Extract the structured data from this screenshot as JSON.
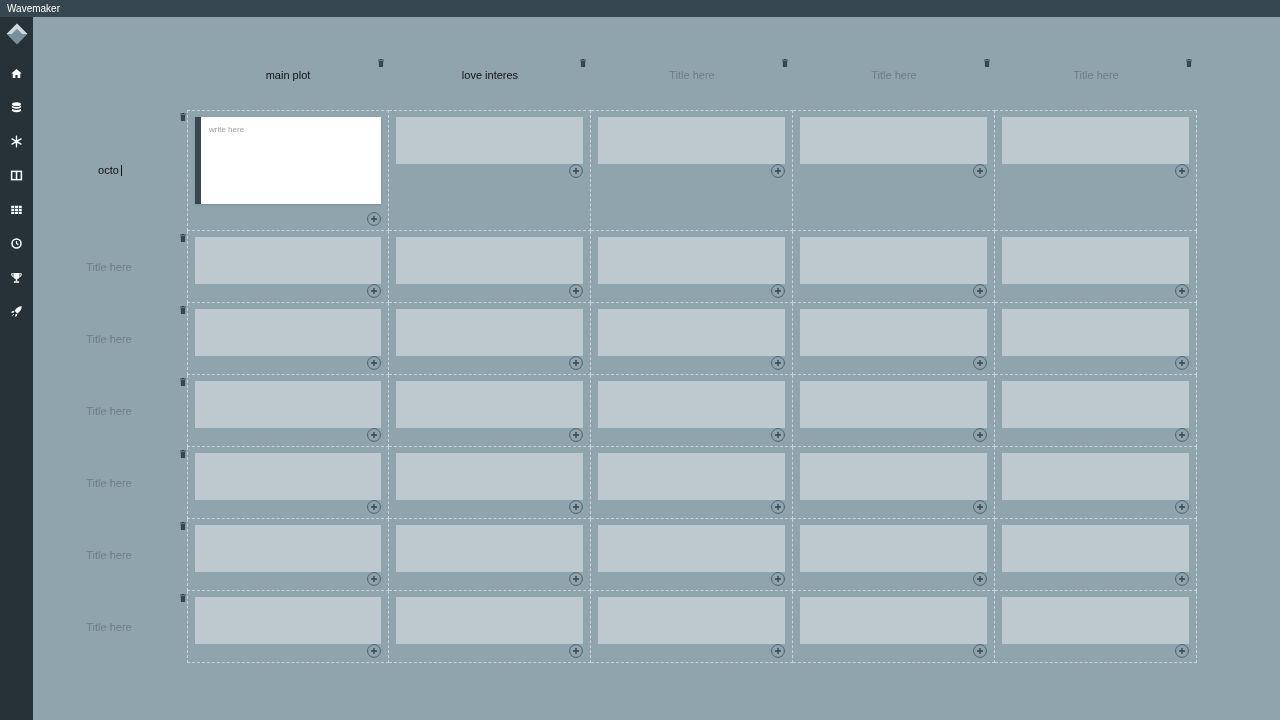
{
  "window": {
    "title": "Wavemaker"
  },
  "sidebar": {
    "items": [
      {
        "kind": "logo"
      },
      {
        "kind": "home"
      },
      {
        "kind": "database"
      },
      {
        "kind": "snowflake"
      },
      {
        "kind": "columns"
      },
      {
        "kind": "grid"
      },
      {
        "kind": "clock"
      },
      {
        "kind": "trophy"
      },
      {
        "kind": "rocket"
      }
    ]
  },
  "columns": [
    {
      "value": "main plot"
    },
    {
      "value": "love interes"
    },
    {
      "placeholder": "Title here"
    },
    {
      "placeholder": "Title here"
    },
    {
      "placeholder": "Title here"
    }
  ],
  "rows": [
    {
      "value": "octo",
      "focused": true,
      "cells": [
        {
          "active": true,
          "placeholder": "write here"
        },
        {
          "active": false
        },
        {
          "active": false
        },
        {
          "active": false
        },
        {
          "active": false
        }
      ]
    },
    {
      "placeholder": "Title here",
      "focused": false,
      "cells": [
        {
          "active": false
        },
        {
          "active": false
        },
        {
          "active": false
        },
        {
          "active": false
        },
        {
          "active": false
        }
      ]
    },
    {
      "placeholder": "Title here",
      "focused": false,
      "cells": [
        {
          "active": false
        },
        {
          "active": false
        },
        {
          "active": false
        },
        {
          "active": false
        },
        {
          "active": false
        }
      ]
    },
    {
      "placeholder": "Title here",
      "focused": false,
      "cells": [
        {
          "active": false
        },
        {
          "active": false
        },
        {
          "active": false
        },
        {
          "active": false
        },
        {
          "active": false
        }
      ]
    },
    {
      "placeholder": "Title here",
      "focused": false,
      "cells": [
        {
          "active": false
        },
        {
          "active": false
        },
        {
          "active": false
        },
        {
          "active": false
        },
        {
          "active": false
        }
      ]
    },
    {
      "placeholder": "Title here",
      "focused": false,
      "cells": [
        {
          "active": false
        },
        {
          "active": false
        },
        {
          "active": false
        },
        {
          "active": false
        },
        {
          "active": false
        }
      ]
    },
    {
      "placeholder": "Title here",
      "focused": false,
      "cells": [
        {
          "active": false
        },
        {
          "active": false
        },
        {
          "active": false
        },
        {
          "active": false
        },
        {
          "active": false
        }
      ]
    }
  ]
}
